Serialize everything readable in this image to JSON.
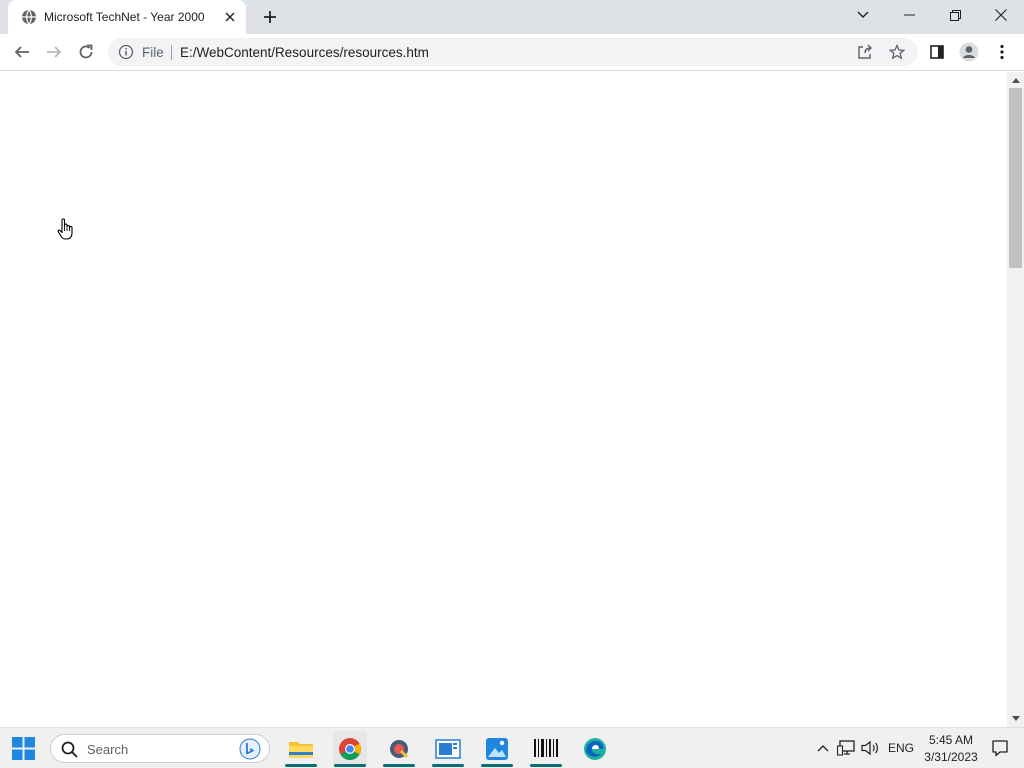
{
  "browser": {
    "tab": {
      "title": "Microsoft TechNet - Year 2000",
      "favicon": "globe-icon"
    },
    "window_controls": [
      "tab-search-icon",
      "minimize-icon",
      "restore-icon",
      "close-icon"
    ],
    "address_bar": {
      "scheme_label": "File",
      "url": "E:/WebContent/Resources/resources.htm"
    },
    "toolbar_icons": [
      "back-icon",
      "forward-icon",
      "reload-icon",
      "share-icon",
      "star-icon",
      "side-panel-icon",
      "profile-icon",
      "menu-icon"
    ]
  },
  "taskbar": {
    "search_placeholder": "Search",
    "apps": [
      "file-explorer-icon",
      "chrome-icon",
      "app-icon",
      "app-icon",
      "photos-icon",
      "barcode-icon",
      "edge-icon"
    ],
    "tray": {
      "language": "ENG",
      "time": "5:45 AM",
      "date": "3/31/2023"
    }
  },
  "colors": {
    "titlebar": "#dee1e6",
    "omnibox": "#f1f3f4",
    "taskbar": "#f0f0f0",
    "accent": "#1a73e8"
  }
}
